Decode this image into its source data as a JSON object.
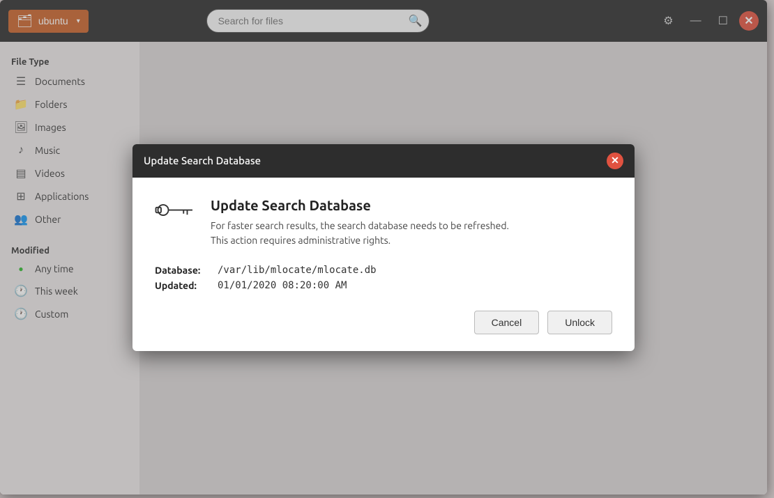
{
  "titlebar": {
    "location_label": "ubuntu",
    "location_chevron": "▾",
    "search_placeholder": "Search for files",
    "search_icon": "🔍",
    "gear_icon": "⚙",
    "minimize_icon": "—",
    "maximize_icon": "☐",
    "close_icon": "✕"
  },
  "sidebar": {
    "file_type_heading": "File Type",
    "items": [
      {
        "id": "documents",
        "label": "Documents",
        "icon": "📄"
      },
      {
        "id": "folders",
        "label": "Folders",
        "icon": "📁"
      },
      {
        "id": "images",
        "label": "Images",
        "icon": "🖼"
      },
      {
        "id": "music",
        "label": "Music",
        "icon": "♪"
      },
      {
        "id": "videos",
        "label": "Videos",
        "icon": "🎞"
      },
      {
        "id": "applications",
        "label": "Applications",
        "icon": "⊞"
      },
      {
        "id": "other",
        "label": "Other",
        "icon": "👥"
      }
    ],
    "modified_heading": "Modified",
    "modified_items": [
      {
        "id": "anytime",
        "label": "Any time",
        "icon": "●",
        "active": true
      },
      {
        "id": "thisweek",
        "label": "This week",
        "icon": "🕐"
      },
      {
        "id": "custom",
        "label": "Custom",
        "icon": "🕐"
      }
    ]
  },
  "dialog": {
    "title": "Update Search Database",
    "close_icon": "✕",
    "heading": "Update Search Database",
    "description_line1": "For faster search results, the search database needs to be refreshed.",
    "description_line2": "This action requires administrative rights.",
    "database_label": "Database:",
    "database_value": "/var/lib/mlocate/mlocate.db",
    "updated_label": "Updated:",
    "updated_value": "01/01/2020 08:20:00 AM",
    "cancel_label": "Cancel",
    "unlock_label": "Unlock"
  }
}
